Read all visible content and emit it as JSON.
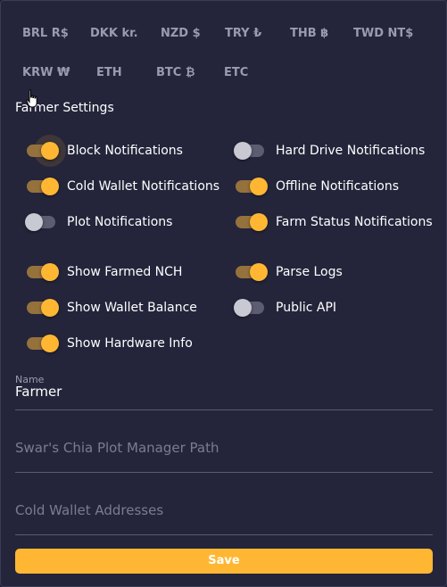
{
  "currencies_row1": [
    "BRL R$",
    "DKK kr.",
    "NZD $",
    "TRY ₺",
    "THB ฿",
    "TWD NT$"
  ],
  "currencies_row2": [
    "KRW ₩",
    "ETH",
    "BTC ₿",
    "ETC"
  ],
  "farmer_settings": {
    "title": "Farmer Settings",
    "toggles": {
      "block_notifications": {
        "label": "Block Notifications",
        "on": true
      },
      "hard_drive_notifications": {
        "label": "Hard Drive Notifications",
        "on": false
      },
      "cold_wallet_notifications": {
        "label": "Cold Wallet Notifications",
        "on": true
      },
      "offline_notifications": {
        "label": "Offline Notifications",
        "on": true
      },
      "plot_notifications": {
        "label": "Plot Notifications",
        "on": false
      },
      "farm_status_notifications": {
        "label": "Farm Status Notifications",
        "on": true
      },
      "show_farmed_nch": {
        "label": "Show Farmed NCH",
        "on": true
      },
      "parse_logs": {
        "label": "Parse Logs",
        "on": true
      },
      "show_wallet_balance": {
        "label": "Show Wallet Balance",
        "on": true
      },
      "public_api": {
        "label": "Public API",
        "on": false
      },
      "show_hardware_info": {
        "label": "Show Hardware Info",
        "on": true
      }
    }
  },
  "fields": {
    "name": {
      "label": "Name",
      "value": "Farmer"
    },
    "swar_path": {
      "placeholder": "Swar's Chia Plot Manager Path"
    },
    "cold_wallet": {
      "placeholder": "Cold Wallet Addresses"
    }
  },
  "save_label": "Save",
  "colors": {
    "accent": "#ffb733",
    "background": "#24253b",
    "muted": "#9a9bb0"
  }
}
